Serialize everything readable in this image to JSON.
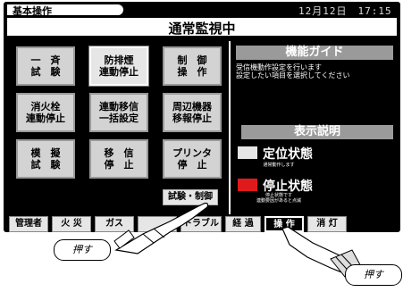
{
  "header": {
    "tab_label": "基本操作",
    "datetime": "12月12日　17:15",
    "title": "通常監視中"
  },
  "buttons": [
    {
      "label": "一　斉\n試　験"
    },
    {
      "label": "防排煙\n連動停止"
    },
    {
      "label": "制　御\n操　作"
    },
    {
      "label": "消火栓\n連動停止"
    },
    {
      "label": "連動移信\n一括設定"
    },
    {
      "label": "周辺機器\n移報停止"
    },
    {
      "label": "模　擬\n試　験"
    },
    {
      "label": "移　信\n停　止"
    },
    {
      "label": "プリンタ\n停　止"
    }
  ],
  "test_control_button": "試験・制御",
  "guide": {
    "title": "機能ガイド",
    "text": "受信機動作設定を行います\n設定したい項目を選択してください"
  },
  "legend": {
    "title": "表示説明",
    "normal": {
      "label": "定位状態",
      "desc": "通常動作します",
      "color": "#e6e6e6"
    },
    "stop": {
      "label": "停止状態",
      "desc": "停止状態です\n連動要因があると点滅",
      "color": "#e01a1a"
    }
  },
  "tabs": [
    {
      "label": "管理者",
      "active": false
    },
    {
      "label": "火 災",
      "active": false
    },
    {
      "label": "ガス",
      "active": false
    },
    {
      "label": "",
      "active": false
    },
    {
      "label": "トラブル",
      "active": false
    },
    {
      "label": "経 過",
      "active": false
    },
    {
      "label": "操 作",
      "active": true
    },
    {
      "label": "消 灯",
      "active": false
    }
  ],
  "callouts": {
    "left": "押す",
    "right": "押す"
  }
}
